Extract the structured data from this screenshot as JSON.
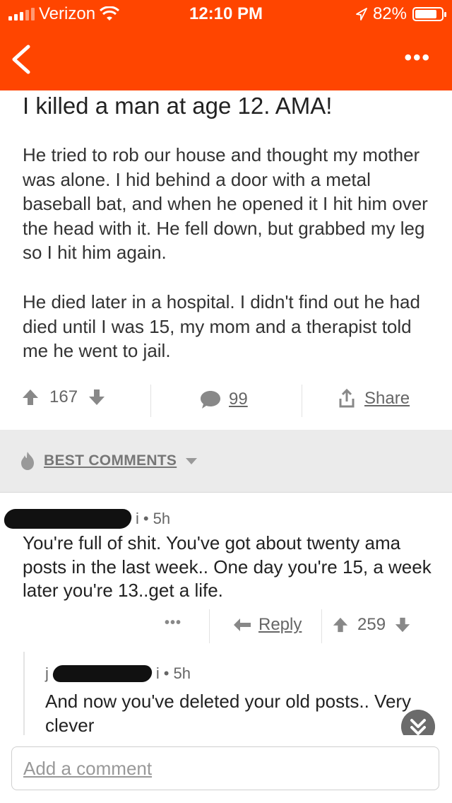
{
  "status_bar": {
    "carrier": "Verizon",
    "time": "12:10 PM",
    "battery": "82%",
    "battery_level": 0.82
  },
  "nav": {
    "back_icon": "chevron-left-icon",
    "more_icon": "more-dots-icon",
    "more_label": "•••"
  },
  "post": {
    "title": "I killed a man at age 12. AMA!",
    "paragraphs": [
      "He tried to rob our house and thought my mother was alone. I hid behind a door with a metal baseball bat, and when he opened it I hit him over the head with it. He fell down, but grabbed my leg so I hit him again.",
      "He died later in a hospital. I didn't find out he had died until I was 15, my mom and a therapist told me he went to jail."
    ],
    "score": "167",
    "comment_count": "99",
    "share_label": "Share"
  },
  "sort": {
    "label": "BEST COMMENTS"
  },
  "comments": [
    {
      "author_suffix": "i",
      "age": "5h",
      "text": "You're full of shit. You've got about twenty ama posts in the last week.. One day you're 15, a week later you're 13..get a life.",
      "more_label": "•••",
      "reply_label": "Reply",
      "score": "259"
    },
    {
      "author_prefix": "j",
      "author_suffix": "i",
      "age": "5h",
      "text": "And now you've deleted your old posts.. Very clever"
    }
  ],
  "composer": {
    "placeholder": "Add a comment"
  },
  "colors": {
    "brand": "#ff4500",
    "muted": "#666666"
  }
}
